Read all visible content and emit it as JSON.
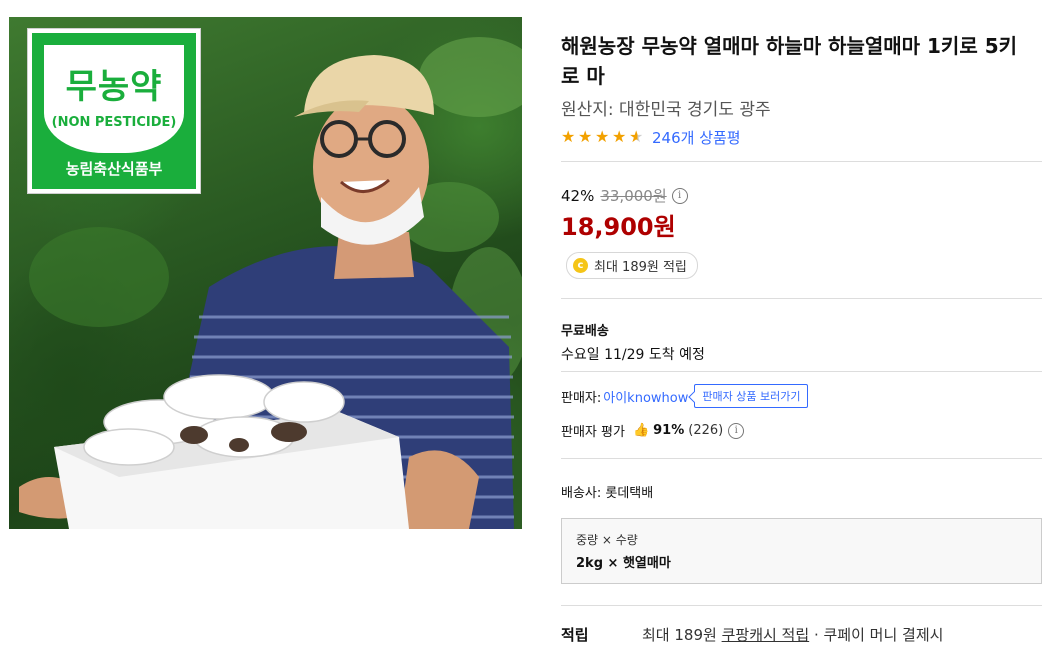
{
  "image": {
    "badge": {
      "title": "무농약",
      "subtitle": "(NON PESTICIDE)",
      "footer": "농림축산식품부"
    }
  },
  "product": {
    "title": "해원농장 무농약 열매마 하늘마 하늘열매마 1키로 5키로 마",
    "origin": "원산지: 대한민국 경기도 광주",
    "rating": 4.5,
    "review_link": "246개 상품평"
  },
  "price": {
    "discount": "42%",
    "original": "33,000원",
    "info_icon": "i",
    "sale": "18,900원",
    "cash_badge": "최대 189원 적립",
    "coin_icon": "c"
  },
  "shipping": {
    "title": "무료배송",
    "eta": "수요일 11/29 도착 예정"
  },
  "seller": {
    "label": "판매자:",
    "name": "아이knowhow",
    "button": "판매자 상품 보러가기",
    "eval_label": "판매자 평가",
    "thumb_icon": "👍",
    "eval_pct": "91%",
    "eval_count": "(226)"
  },
  "carrier": "배송사: 롯데택배",
  "option": {
    "labels": "중량 × 수량",
    "value": "2kg × 햇열매마"
  },
  "cashback": {
    "label": "적립",
    "prefix": "최대 189원",
    "link": "쿠팡캐시 적립",
    "suffix": "· 쿠페이 머니 결제시"
  },
  "colors": {
    "accent_blue": "#346aff",
    "price_red": "#ae0000",
    "star": "#f2a100",
    "badge_green": "#1aae3c"
  }
}
